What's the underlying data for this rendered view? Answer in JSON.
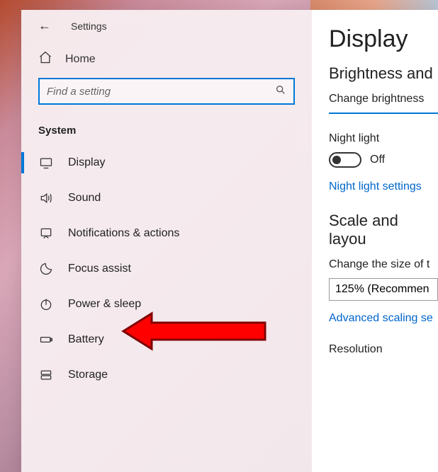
{
  "header": {
    "title": "Settings"
  },
  "home": {
    "label": "Home"
  },
  "search": {
    "placeholder": "Find a setting"
  },
  "section": {
    "title": "System"
  },
  "nav": {
    "display": "Display",
    "sound": "Sound",
    "notifications": "Notifications & actions",
    "focus": "Focus assist",
    "power": "Power & sleep",
    "battery": "Battery",
    "storage": "Storage"
  },
  "content": {
    "title": "Display",
    "brightness_heading": "Brightness and",
    "change_brightness": "Change brightness",
    "night_light_label": "Night light",
    "toggle_off": "Off",
    "night_light_link": "Night light settings",
    "scale_heading": "Scale and layou",
    "change_size": "Change the size of t",
    "scale_value": "125% (Recommen",
    "advanced_link": "Advanced scaling se",
    "resolution_label": "Resolution"
  }
}
